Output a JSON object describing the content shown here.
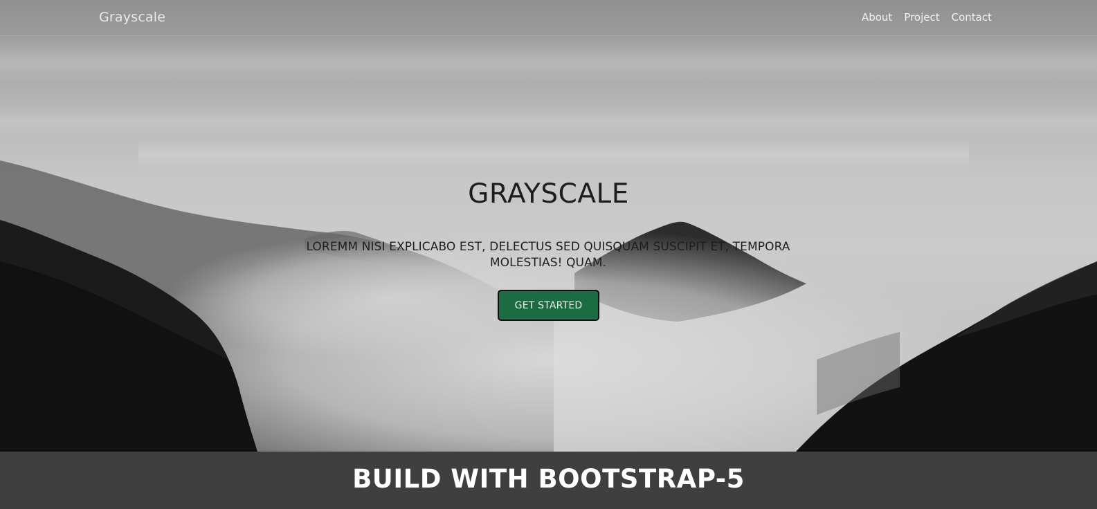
{
  "navbar": {
    "brand": "Grayscale",
    "links": [
      {
        "label": "About"
      },
      {
        "label": "Project"
      },
      {
        "label": "Contact"
      }
    ]
  },
  "hero": {
    "title": "GRAYSCALE",
    "subtitle": "LOREMM NISI EXPLICABO EST, DELECTUS SED QUISQUAM SUSCIPIT ET, TEMPORA MOLESTIAS! QUAM.",
    "cta_label": "GET STARTED",
    "background_image": "misty-mountains-grayscale"
  },
  "banner": {
    "title": "BUILD WITH BOOTSTRAP-5"
  },
  "colors": {
    "cta_background": "#1b6b43",
    "banner_background": "#3f3f3f",
    "text_dark": "#1d1d1d"
  }
}
